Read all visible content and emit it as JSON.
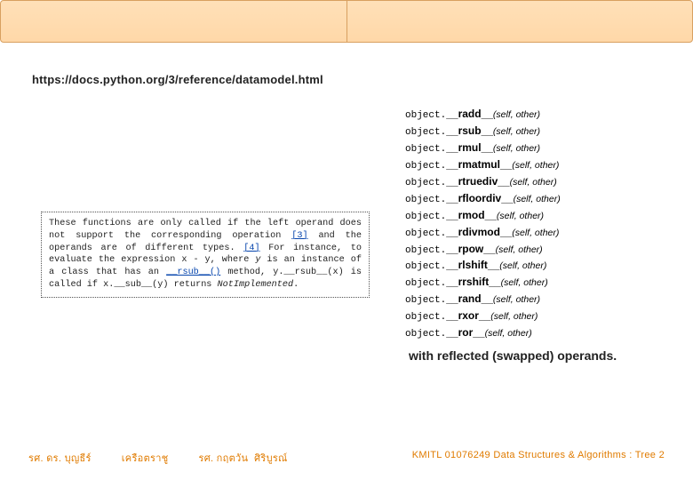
{
  "url": "https://docs.python.org/3/reference/datamodel.html",
  "description": {
    "text_before_link1": "These functions are only called if the left operand does not support the corresponding operation ",
    "link1": "[3]",
    "text_mid1": " and the operands are of different types. ",
    "link2": "[4]",
    "text_mid2": " For instance, to evaluate the expression ",
    "expr1": "x - y",
    "text_mid3": ", where ",
    "y": "y",
    "text_mid4": " is an instance of a class that has an ",
    "rsub_link": "__rsub__()",
    "text_mid5": " method, ",
    "call": "y.__rsub__(x)",
    "text_mid6": " is called if ",
    "call2": "x.__sub__(y)",
    "text_mid7": " returns ",
    "notimpl": "NotImplemented",
    "period": "."
  },
  "methods": [
    {
      "prefix": "object.",
      "name": "__radd__",
      "args": "(self, other)"
    },
    {
      "prefix": "object.",
      "name": "__rsub__",
      "args": "(self, other)"
    },
    {
      "prefix": "object.",
      "name": "__rmul__",
      "args": "(self, other)"
    },
    {
      "prefix": "object.",
      "name": "__rmatmul__",
      "args": "(self, other)"
    },
    {
      "prefix": "object.",
      "name": "__rtruediv__",
      "args": "(self, other)"
    },
    {
      "prefix": "object.",
      "name": "__rfloordiv__",
      "args": "(self, other)"
    },
    {
      "prefix": "object.",
      "name": "__rmod__",
      "args": "(self, other)"
    },
    {
      "prefix": "object.",
      "name": "__rdivmod__",
      "args": "(self, other)"
    },
    {
      "prefix": "object.",
      "name": "__rpow__",
      "args": "(self, other)"
    },
    {
      "prefix": "object.",
      "name": "__rlshift__",
      "args": "(self, other)"
    },
    {
      "prefix": "object.",
      "name": "__rrshift__",
      "args": "(self, other)"
    },
    {
      "prefix": "object.",
      "name": "__rand__",
      "args": "(self, other)"
    },
    {
      "prefix": "object.",
      "name": "__rxor__",
      "args": "(self, other)"
    },
    {
      "prefix": "object.",
      "name": "__ror__",
      "args": "(self, other)"
    }
  ],
  "reflected_text": "with reflected (swapped) operands.",
  "footer": {
    "author1": "รศ. ดร. บุญธีร์",
    "author2": "เครือตราชู",
    "author3": "รศ. กฤตวัน",
    "author4": "ศิริบูรณ์",
    "right": "KMITL   01076249 Data Structures & Algorithms : Tree 2"
  }
}
